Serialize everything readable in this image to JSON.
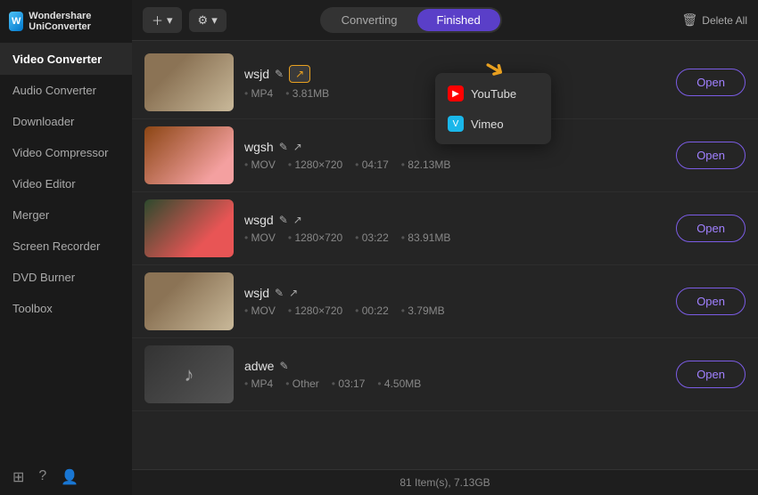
{
  "app": {
    "name": "Wondershare UniConverter",
    "logo_text": "W"
  },
  "sidebar": {
    "active_item": "Video Converter",
    "items": [
      {
        "label": "Audio Converter",
        "id": "audio-converter"
      },
      {
        "label": "Downloader",
        "id": "downloader"
      },
      {
        "label": "Video Compressor",
        "id": "video-compressor"
      },
      {
        "label": "Video Editor",
        "id": "video-editor"
      },
      {
        "label": "Merger",
        "id": "merger"
      },
      {
        "label": "Screen Recorder",
        "id": "screen-recorder"
      },
      {
        "label": "DVD Burner",
        "id": "dvd-burner"
      },
      {
        "label": "Toolbox",
        "id": "toolbox"
      }
    ]
  },
  "toolbar": {
    "add_btn": "＋",
    "settings_btn": "⚙",
    "tab_converting": "Converting",
    "tab_finished": "Finished",
    "delete_all": "Delete All"
  },
  "files": [
    {
      "id": "file-1",
      "name": "wsjd",
      "format": "MP4",
      "resolution": "",
      "duration": "",
      "size": "3.81MB",
      "thumb_class": "thumb-1",
      "has_share": true,
      "show_share_arrow": true
    },
    {
      "id": "file-2",
      "name": "wgsh",
      "format": "MOV",
      "resolution": "1280×720",
      "duration": "04:17",
      "size": "82.13MB",
      "thumb_class": "thumb-2",
      "has_share": false
    },
    {
      "id": "file-3",
      "name": "wsgd",
      "format": "MOV",
      "resolution": "1280×720",
      "duration": "03:22",
      "size": "83.91MB",
      "thumb_class": "thumb-3",
      "has_share": false
    },
    {
      "id": "file-4",
      "name": "wsjd",
      "format": "MOV",
      "resolution": "1280×720",
      "duration": "00:22",
      "size": "3.79MB",
      "thumb_class": "thumb-4",
      "has_share": false
    },
    {
      "id": "file-5",
      "name": "adwe",
      "format": "MP4",
      "resolution": "Other",
      "duration": "03:17",
      "size": "4.50MB",
      "thumb_class": "thumb-5",
      "has_share": false
    }
  ],
  "share_dropdown": {
    "items": [
      {
        "label": "YouTube",
        "icon": "yt"
      },
      {
        "label": "Vimeo",
        "icon": "vm"
      }
    ]
  },
  "footer": {
    "label": "81 Item(s), 7.13GB"
  },
  "colors": {
    "accent": "#7B5CE5",
    "share_border": "#e8a020"
  }
}
